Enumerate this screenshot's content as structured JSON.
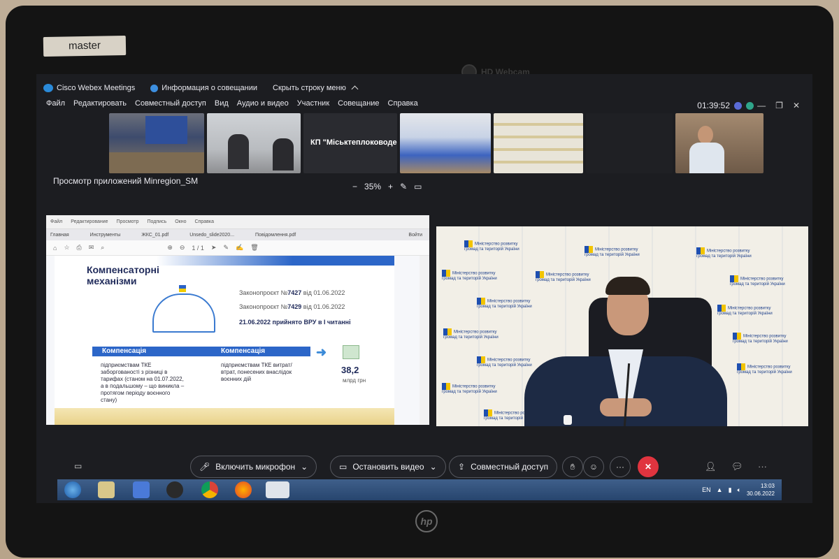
{
  "device": {
    "sticker": "master",
    "webcam_label": "HD Webcam",
    "brand": "hp"
  },
  "webex": {
    "app_name": "Cisco Webex Meetings",
    "meeting_info": "Информация о совещании",
    "hide_menu": "Скрыть строку меню",
    "menu": [
      "Файл",
      "Редактировать",
      "Совместный доступ",
      "Вид",
      "Аудио и видео",
      "Участник",
      "Совещание",
      "Справка"
    ],
    "clock": "01:39:52",
    "participant_tile_label": "КП \"Міськтеплоководе...",
    "app_view_title": "Просмотр приложений Minregion_SM",
    "zoom_minus": "−",
    "zoom_level": "35%",
    "zoom_plus": "+"
  },
  "pdf": {
    "menu": [
      "Файл",
      "Редактирование",
      "Просмотр",
      "Подпись",
      "Окно",
      "Справка"
    ],
    "tabs": [
      "Главная",
      "Инструменты",
      "ЖКС_01.pdf",
      "Unsedo_slide2020...",
      "Повідомлення.pdf"
    ],
    "signin": "Войти",
    "page_nav": "1 / 1"
  },
  "slide": {
    "title": "Компенсаторні механізми",
    "bill1_prefix": "Законопроєкт №",
    "bill1_num": "7427",
    "bill1_suffix": " від 01.06.2022",
    "bill2_prefix": "Законопроєкт №",
    "bill2_num": "7429",
    "bill2_suffix": " від 01.06.2022",
    "reading": "21.06.2022 прийнято ВРУ в І читанні",
    "comp_label_1": "Компенсація",
    "comp_label_2": "Компенсація",
    "comp_text_1": "підприємствам ТКЕ заборгованості з різниці в тарифах (станом на 01.07.2022, а в подальшому – що виникла – протягом періоду воєнного стану)",
    "comp_text_2": "підприємствам ТКЕ витрат/втрат, понесених внаслідок воєнних дій",
    "amount": "38,2",
    "amount_unit": "млрд грн"
  },
  "backdrop": {
    "logo_line1": "Міністерство розвитку",
    "logo_line2": "громад та територій України"
  },
  "controls": {
    "mic": "Включить микрофон",
    "video": "Остановить видео",
    "share": "Совместный доступ",
    "more": "···",
    "end": "✕"
  },
  "taskbar": {
    "lang": "EN",
    "time": "13:03",
    "date": "30.06.2022"
  },
  "colors": {
    "accent_blue": "#2c66c8",
    "end_red": "#e0343f",
    "screen_bg": "#1c1d21"
  }
}
